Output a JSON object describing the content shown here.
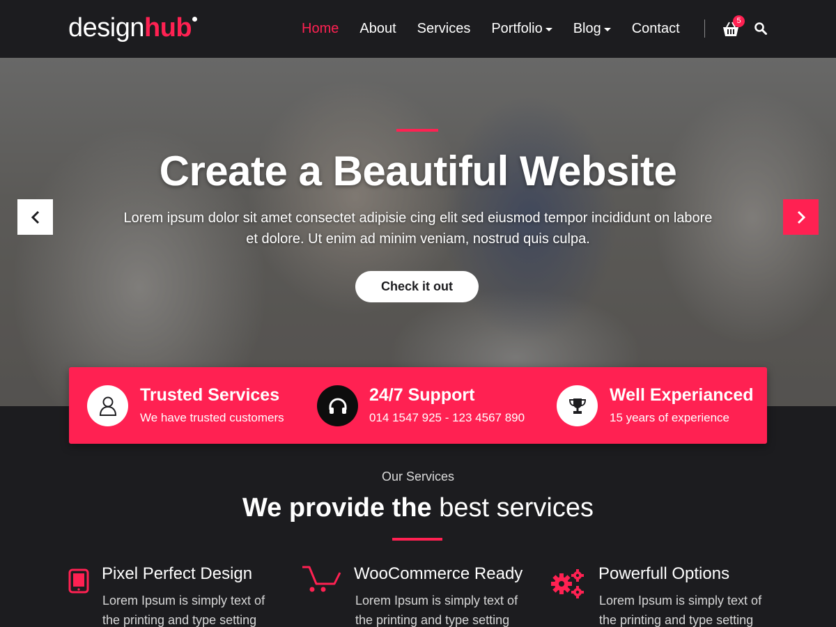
{
  "brand": {
    "part1": "design",
    "part2": "hub"
  },
  "nav": {
    "items": [
      {
        "label": "Home",
        "active": true,
        "dropdown": false
      },
      {
        "label": "About",
        "active": false,
        "dropdown": false
      },
      {
        "label": "Services",
        "active": false,
        "dropdown": false
      },
      {
        "label": "Portfolio",
        "active": false,
        "dropdown": true
      },
      {
        "label": "Blog",
        "active": false,
        "dropdown": true
      },
      {
        "label": "Contact",
        "active": false,
        "dropdown": false
      }
    ],
    "cart_count": "5",
    "cart_icon": "shopping-basket-icon",
    "search_icon": "search-icon"
  },
  "hero": {
    "title": "Create a Beautiful Website",
    "text": "Lorem ipsum dolor sit amet consectet adipisie cing elit sed eiusmod tempor incididunt on labore et dolore. Ut enim ad minim veniam, nostrud quis culpa.",
    "button_label": "Check it out",
    "prev_icon": "chevron-left-icon",
    "next_icon": "chevron-right-icon"
  },
  "features": [
    {
      "title": "Trusted Services",
      "subtitle": "We have trusted customers",
      "icon": "user-icon"
    },
    {
      "title": "24/7 Support",
      "subtitle": "014 1547 925 - 123 4567 890",
      "icon": "headphones-icon"
    },
    {
      "title": "Well Experianced",
      "subtitle": "15 years of experience",
      "icon": "trophy-icon"
    }
  ],
  "services": {
    "eyebrow": "Our Services",
    "heading_bold": "We provide the",
    "heading_light": "best services",
    "items": [
      {
        "title": "Pixel Perfect Design",
        "desc": "Lorem Ipsum is simply text of the printing and type setting",
        "icon": "tablet-icon"
      },
      {
        "title": "WooCommerce Ready",
        "desc": "Lorem Ipsum is simply text of the printing and type setting",
        "icon": "cart-icon"
      },
      {
        "title": "Powerfull Options",
        "desc": "Lorem Ipsum is simply text of the printing and type setting",
        "icon": "gears-icon"
      }
    ]
  },
  "colors": {
    "accent": "#ff2152",
    "background": "#1c1c1f",
    "text": "#ffffff"
  }
}
